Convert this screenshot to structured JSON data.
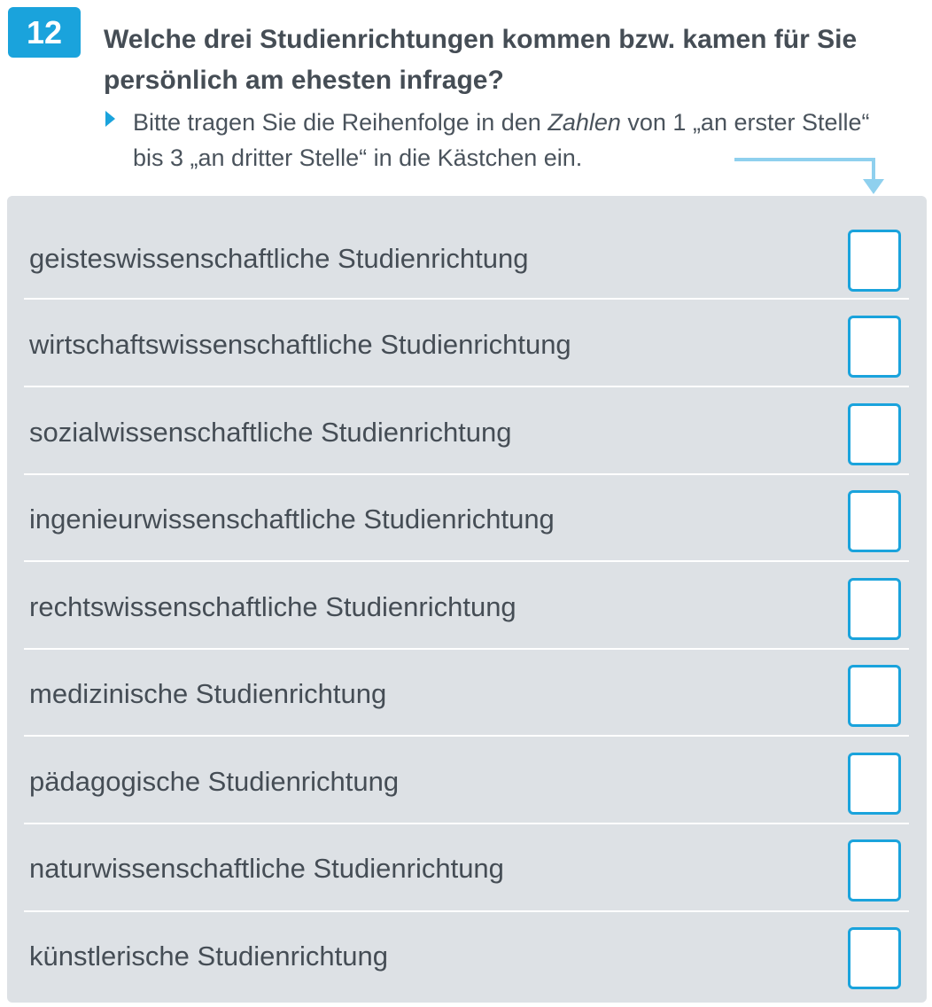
{
  "question": {
    "number": "12",
    "title": "Welche drei Studienrichtungen kommen bzw. kamen für Sie persönlich am ehesten infrage?",
    "instruction_before": "Bitte tragen Sie die Reihenfolge in den ",
    "instruction_emphasis": "Zahlen",
    "instruction_after": " von 1 „an erster Stelle“ bis 3 „an dritter Stelle“ in die Kästchen ein."
  },
  "options": [
    {
      "label": "geisteswissenschaftliche Studienrichtung",
      "value": ""
    },
    {
      "label": "wirtschaftswissenschaftliche Studienrichtung",
      "value": ""
    },
    {
      "label": "sozialwissenschaftliche Studienrichtung",
      "value": ""
    },
    {
      "label": "ingenieurwissenschaftliche Studienrichtung",
      "value": ""
    },
    {
      "label": "rechtswissenschaftliche Studienrichtung",
      "value": ""
    },
    {
      "label": "medizinische Studienrichtung",
      "value": ""
    },
    {
      "label": "pädagogische Studienrichtung",
      "value": ""
    },
    {
      "label": "naturwissenschaftliche Studienrichtung",
      "value": ""
    },
    {
      "label": "künstlerische Studienrichtung",
      "value": ""
    }
  ],
  "colors": {
    "accent": "#1aa3dc",
    "arrow": "#8fd0ee",
    "panel": "#dde1e5",
    "text": "#454d55"
  }
}
